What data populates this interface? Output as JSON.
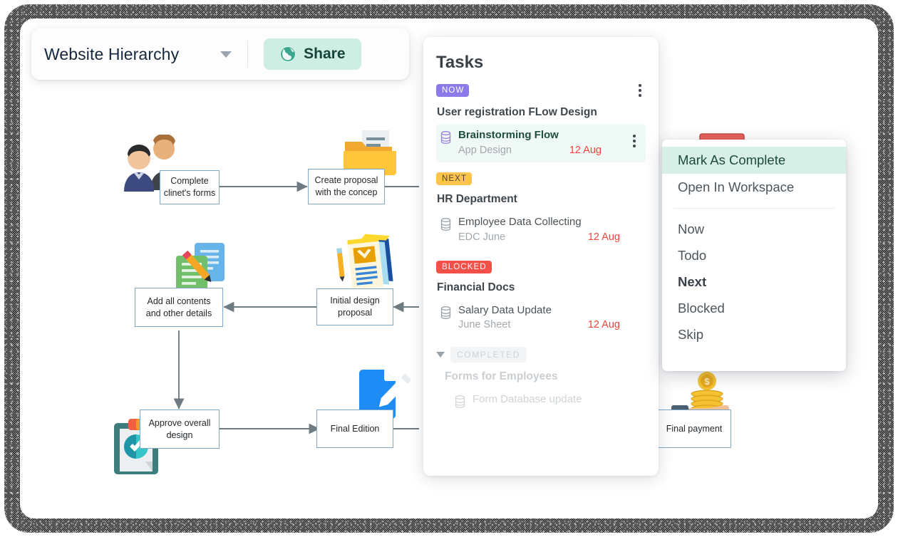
{
  "topbar": {
    "doc_title": "Website Hierarchy",
    "dropdown_icon": "chevron-down-icon",
    "share_label": "Share",
    "share_icon": "globe-icon",
    "share_bg": "#cdeee2"
  },
  "diagram": {
    "nodes": [
      {
        "id": "complete-clients-forms",
        "line1": "Complete",
        "line2": "clinet's forms"
      },
      {
        "id": "create-proposal",
        "line1": "Create proposal",
        "line2": "with the concep"
      },
      {
        "id": "add-all-contents",
        "line1": "Add all contents",
        "line2": "and other details"
      },
      {
        "id": "initial-design-proposal",
        "line1": "Initial design",
        "line2": "proposal"
      },
      {
        "id": "approve-overall-design",
        "line1": "Approve overall",
        "line2": "design"
      },
      {
        "id": "final-edition",
        "line1": "Final Edition",
        "line2": ""
      },
      {
        "id": "final-payment",
        "line1": "Final  payment",
        "line2": ""
      }
    ],
    "illustrations": [
      {
        "id": "people-avatars-illustration"
      },
      {
        "id": "folder-document-illustration"
      },
      {
        "id": "documents-pencil-illustration"
      },
      {
        "id": "books-stack-illustration"
      },
      {
        "id": "clipboard-check-illustration"
      },
      {
        "id": "document-edit-illustration"
      },
      {
        "id": "hand-coins-illustration"
      }
    ],
    "border_color": "#7fa8c9",
    "connector_color": "#6f7b82"
  },
  "tasks": {
    "title": "Tasks",
    "groups": [
      {
        "badge": "NOW",
        "badge_style": "now",
        "name": "User registration FLow Design",
        "has_kebab": true,
        "items": [
          {
            "title": "Brainstorming Flow",
            "project": "App Design",
            "date": "12 Aug",
            "active": true,
            "icon": "database-icon",
            "has_kebab": true
          }
        ]
      },
      {
        "badge": "NEXT",
        "badge_style": "next",
        "name": "HR Department",
        "has_kebab": false,
        "items": [
          {
            "title": "Employee Data Collecting",
            "project": "EDC June",
            "date": "12 Aug",
            "active": false,
            "icon": "database-icon",
            "has_kebab": false
          }
        ]
      },
      {
        "badge": "BLOCKED",
        "badge_style": "blocked",
        "name": "Financial Docs",
        "has_kebab": false,
        "items": [
          {
            "title": "Salary Data Update",
            "project": "June Sheet",
            "date": "12 Aug",
            "active": false,
            "icon": "database-icon",
            "has_kebab": false
          }
        ]
      }
    ],
    "completed": {
      "badge": "COMPLETED",
      "toggle_icon": "triangle-down-icon",
      "group_name": "Forms for Employees",
      "items": [
        {
          "title": "Form Database update",
          "icon": "database-icon"
        }
      ]
    },
    "badge_colors": {
      "now": "#8d7ae8",
      "next": "#fcc34d",
      "blocked": "#f4504a",
      "completed": "#f2f4f5"
    },
    "date_color": "#f2433c",
    "active_row_bg": "#effaf6"
  },
  "context_menu": {
    "primary": [
      {
        "label": "Mark As Complete",
        "highlight": true
      },
      {
        "label": "Open In Workspace",
        "highlight": false
      }
    ],
    "states": [
      {
        "label": "Now",
        "bold": false
      },
      {
        "label": "Todo",
        "bold": false
      },
      {
        "label": "Next",
        "bold": true
      },
      {
        "label": "Blocked",
        "bold": false
      },
      {
        "label": "Skip",
        "bold": false
      }
    ],
    "highlight_bg": "#d7efe7"
  }
}
